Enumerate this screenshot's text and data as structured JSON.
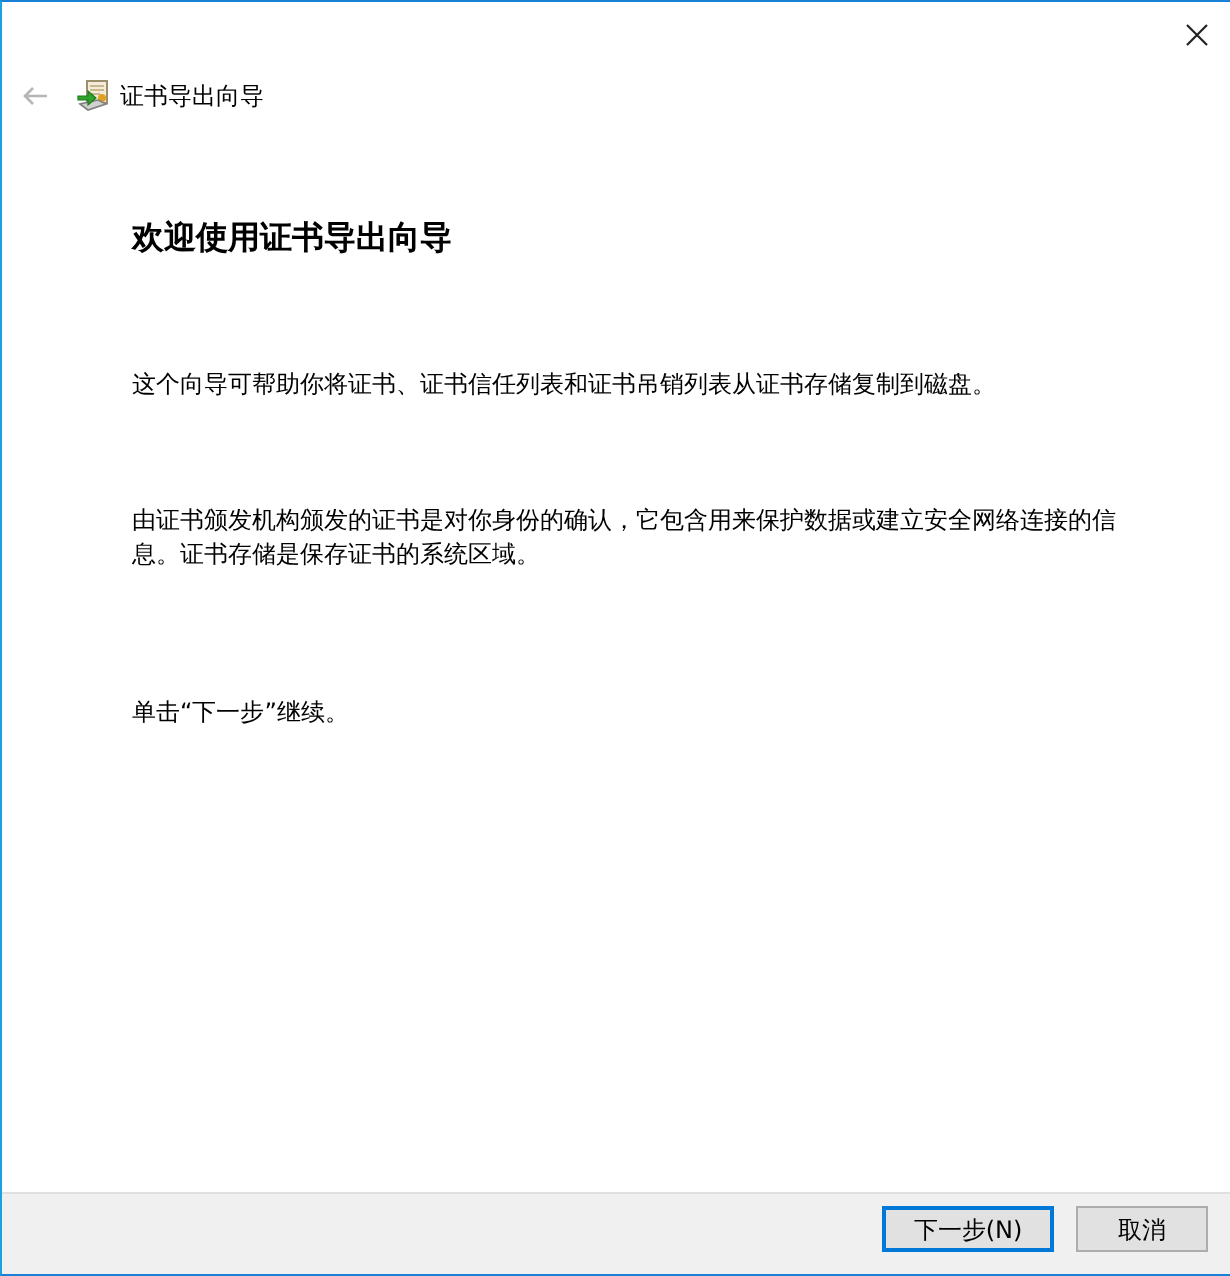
{
  "window": {
    "title": "证书导出向导",
    "back_button": {
      "disabled": true
    }
  },
  "heading": "欢迎使用证书导出向导",
  "paragraphs": [
    "这个向导可帮助你将证书、证书信任列表和证书吊销列表从证书存储复制到磁盘。",
    "由证书颁发机构颁发的证书是对你身份的确认，它包含用来保护数据或建立安全网络连接的信息。证书存储是保存证书的系统区域。",
    "单击“下一步”继续。"
  ],
  "buttons": [
    {
      "label": "下一步(N)",
      "default": true
    },
    {
      "label": "取消",
      "default": false
    }
  ]
}
